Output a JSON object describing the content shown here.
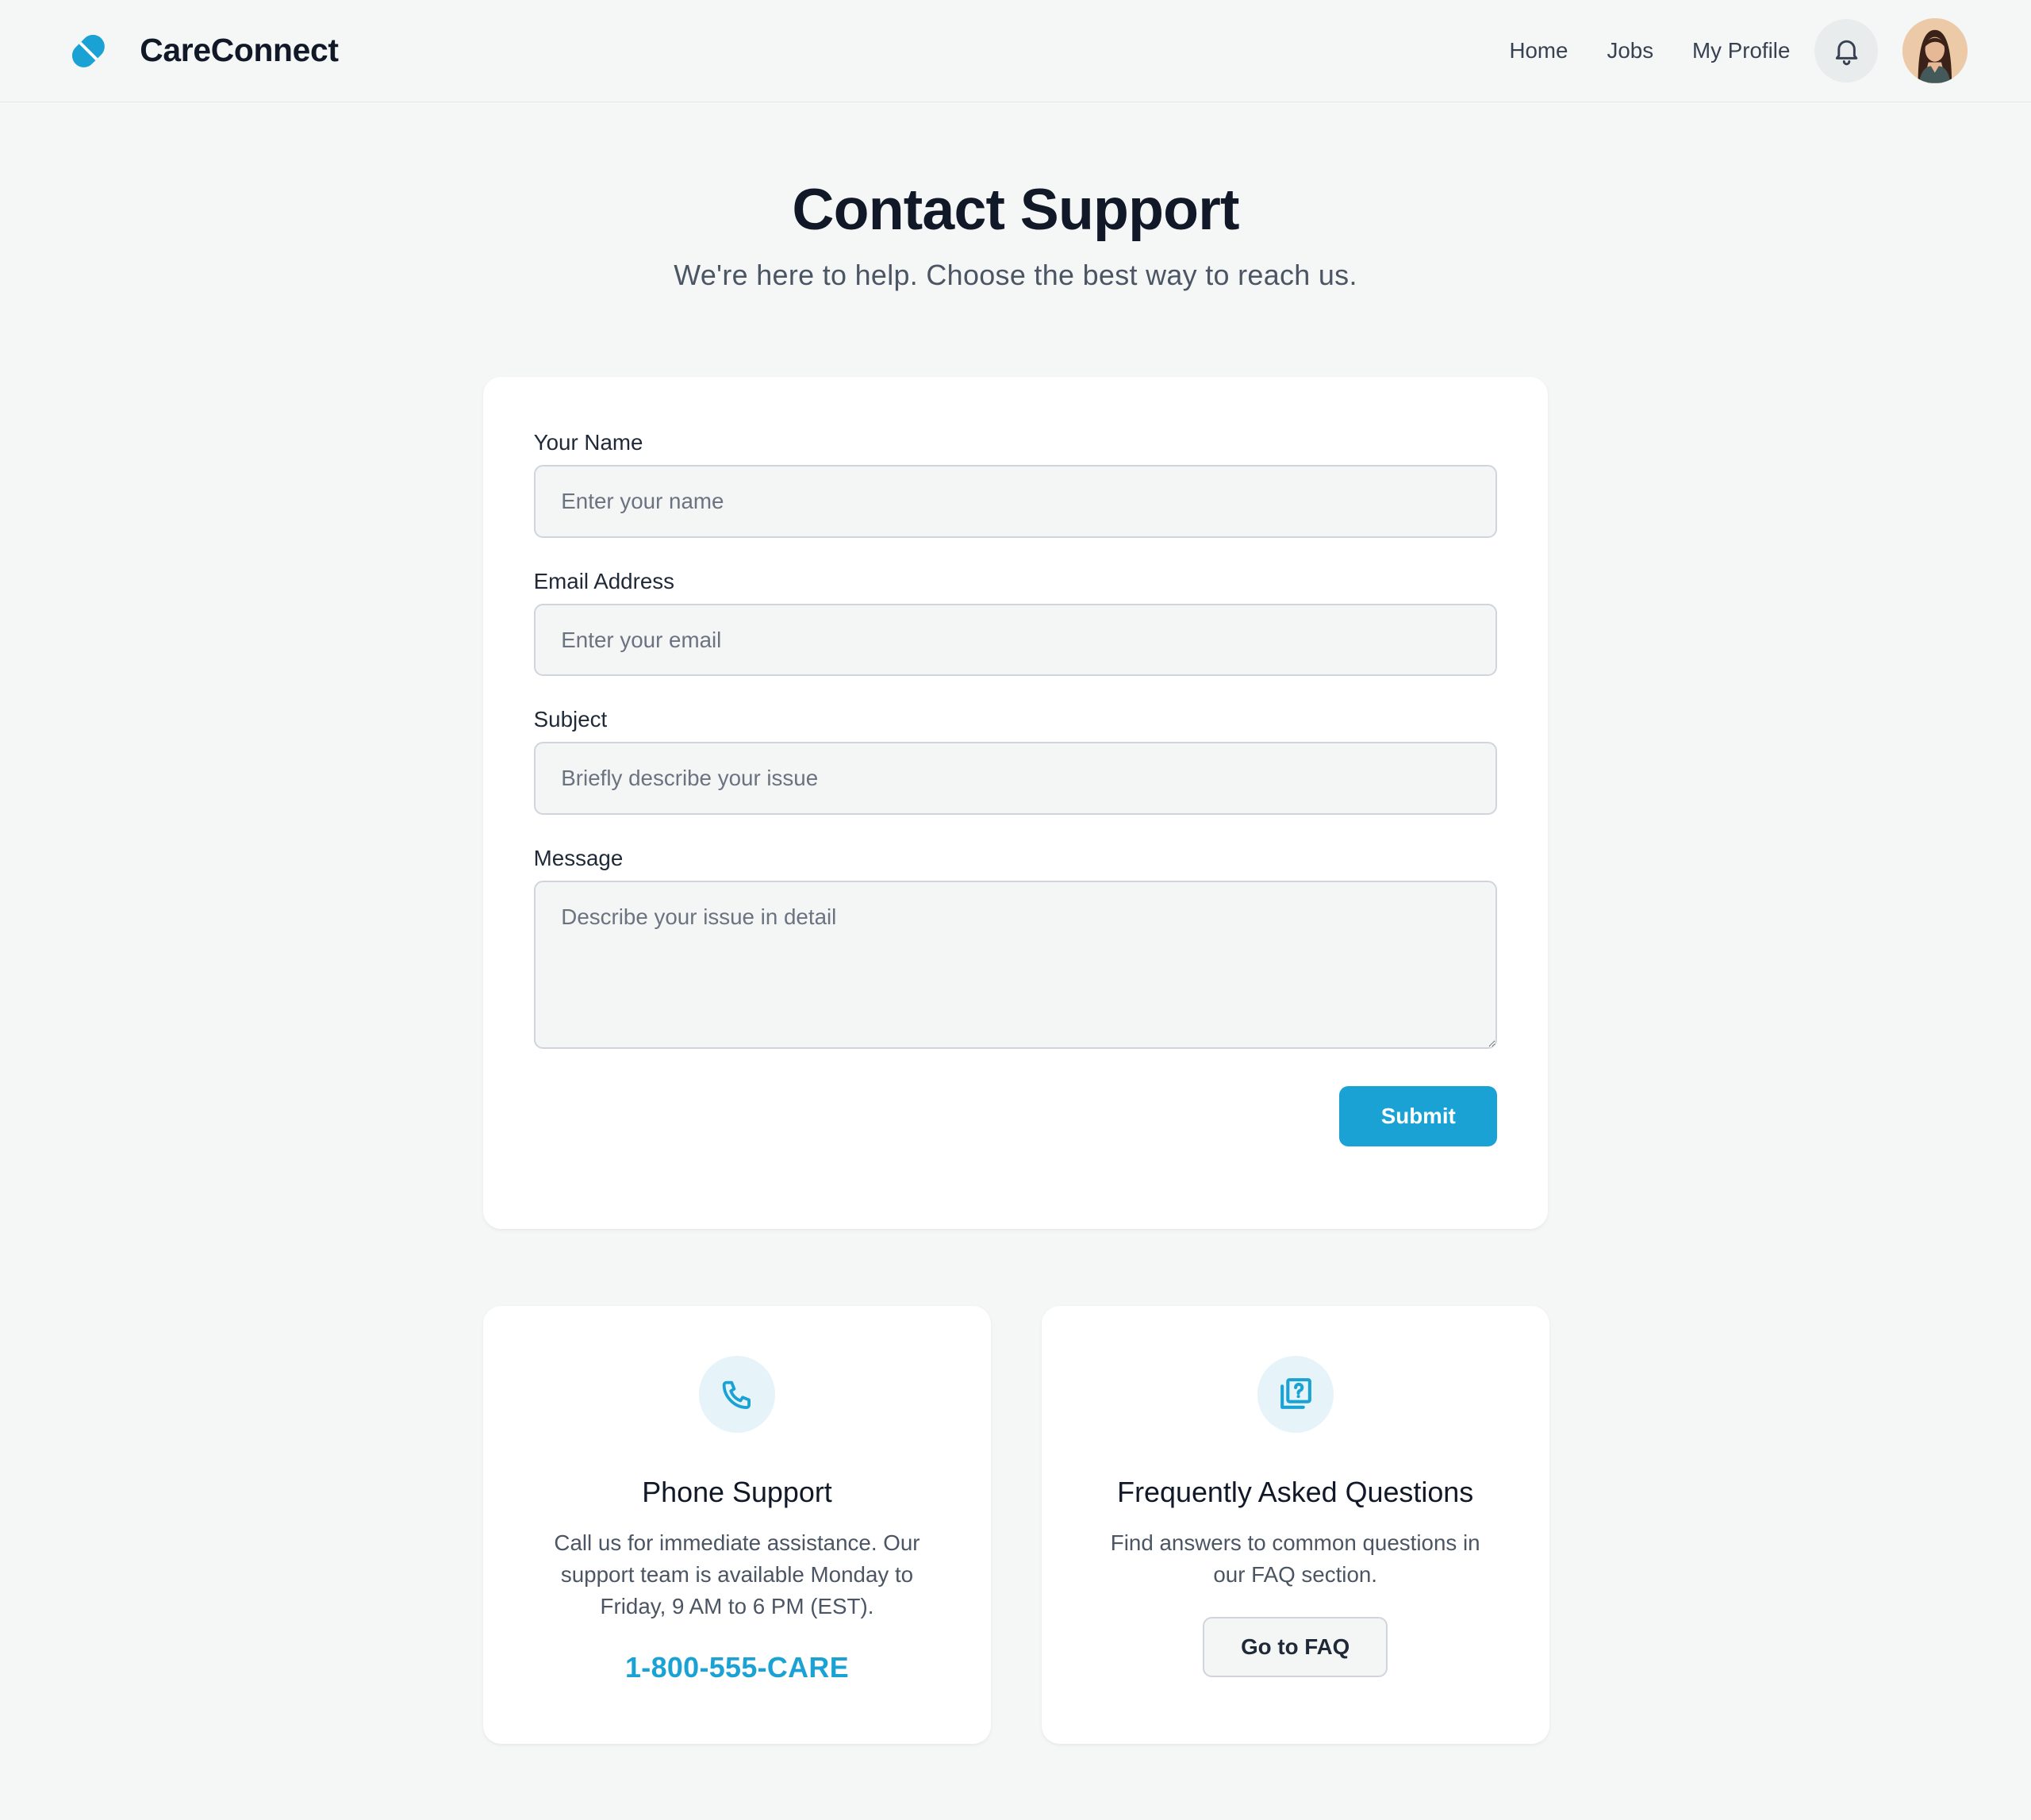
{
  "app": {
    "name": "CareConnect"
  },
  "nav": {
    "home": "Home",
    "jobs": "Jobs",
    "profile": "My Profile"
  },
  "page": {
    "title": "Contact Support",
    "subtitle": "We're here to help. Choose the best way to reach us."
  },
  "form": {
    "name_label": "Your Name",
    "name_placeholder": "Enter your name",
    "name_value": "",
    "email_label": "Email Address",
    "email_placeholder": "Enter your email",
    "email_value": "",
    "subject_label": "Subject",
    "subject_placeholder": "Briefly describe your issue",
    "subject_value": "",
    "message_label": "Message",
    "message_placeholder": "Describe your issue in detail",
    "message_value": "",
    "submit_label": "Submit"
  },
  "phone_card": {
    "icon": "phone-icon",
    "title": "Phone Support",
    "text": "Call us for immediate assistance. Our support team is available Monday to Friday, 9 AM to 6 PM (EST).",
    "number": "1-800-555-CARE"
  },
  "faq_card": {
    "icon": "faq-icon",
    "title": "Frequently Asked Questions",
    "text": "Find answers to common questions in our FAQ section.",
    "button_label": "Go to FAQ"
  },
  "colors": {
    "accent": "#1aa2d4",
    "background": "#f5f7f7",
    "card": "#ffffff",
    "text_primary": "#111827",
    "text_secondary": "#4b5563"
  }
}
